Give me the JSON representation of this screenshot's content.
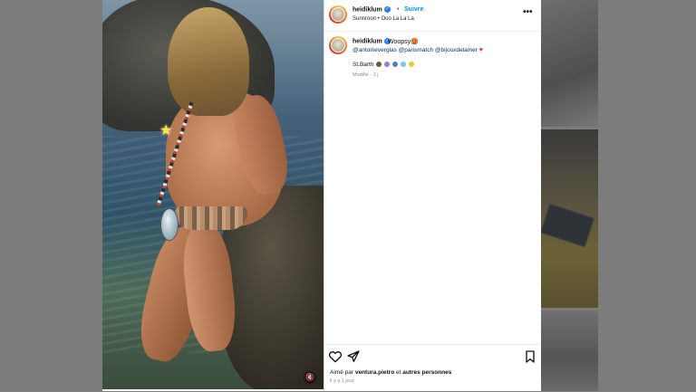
{
  "post": {
    "username": "heidiklum",
    "follow_label": "Suivre",
    "separator": "•",
    "audio": "Sunnroon • Ooo La La La",
    "more_icon": "more-horizontal-icon",
    "caption": {
      "username": "heidiklum",
      "text": "Woopsy",
      "mentions": "@antoineverglas @parismatch @bijouxdelamer",
      "place": "St.Barth",
      "edited": "Modifié · 1 j"
    },
    "likes": {
      "prefix": "Aimé par",
      "user": "ventura.pietro",
      "middle": "et",
      "suffix": "autres personnes"
    },
    "timestamp": "il y a 1 jour"
  },
  "colors": {
    "accent": "#0095f6",
    "mention": "#00376b",
    "verified": "#2b7cf0",
    "muted": "#8e8e8e"
  },
  "icons": [
    "heart-icon",
    "share-icon",
    "bookmark-icon",
    "mute-icon",
    "verified-badge-icon"
  ]
}
